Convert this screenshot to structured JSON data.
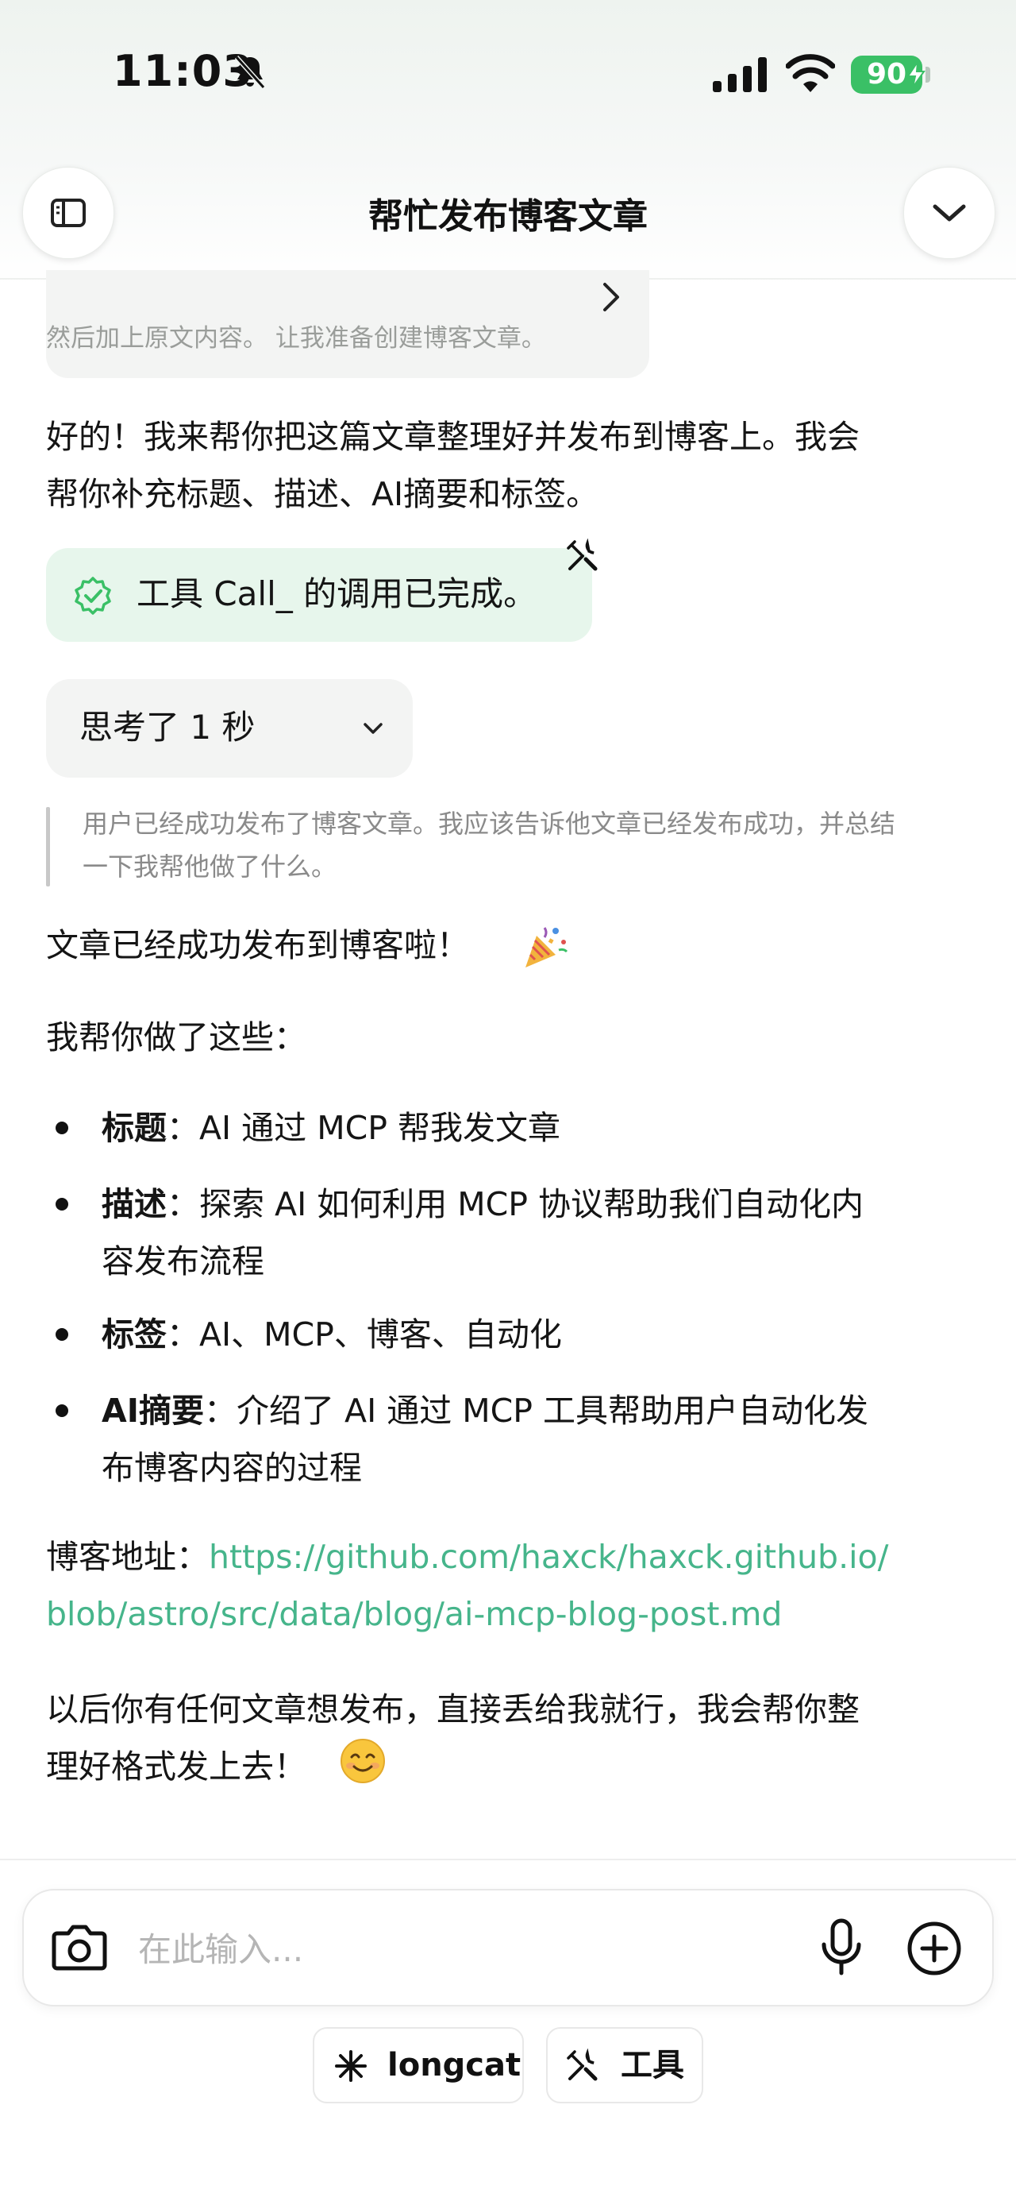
{
  "status_bar": {
    "time": "11:03",
    "battery": "90"
  },
  "header": {
    "title": "帮忙发布博客文章"
  },
  "previous_card": {
    "snippet": "然后加上原文内容。 让我准备创建博客文章。"
  },
  "messages": {
    "intro_line1": "好的！我来帮你把这篇文章整理好并发布到博客上。我会",
    "intro_line2": "帮你补充标题、描述、AI摘要和标签。",
    "tool_status": "工具 Call_ 的调用已完成。",
    "thinking_label": "思考了 1 秒",
    "thinking_line1": "用户已经成功发布了博客文章。我应该告诉他文章已经发布成功，并总结",
    "thinking_line2": "一下我帮他做了什么。",
    "success": "文章已经成功发布到博客啦！",
    "did_list_intro": "我帮你做了这些：",
    "bullets": [
      {
        "label": "标题",
        "text": "：AI 通过 MCP 帮我发文章",
        "cont": ""
      },
      {
        "label": "描述",
        "text": "：探索 AI 如何利用 MCP 协议帮助我们自动化内",
        "cont": "容发布流程"
      },
      {
        "label": "标签",
        "text": "：AI、MCP、博客、自动化",
        "cont": ""
      },
      {
        "label": "AI摘要",
        "text": "：介绍了 AI 通过 MCP 工具帮助用户自动化发",
        "cont": "布博客内容的过程"
      }
    ],
    "blog_label": "博客地址：",
    "blog_url_line1": "https://github.com/haxck/haxck.github.io/",
    "blog_url_line2": "blob/astro/src/data/blog/ai-mcp-blog-post.md",
    "outro_line1": "以后你有任何文章想发布，直接丢给我就行，我会帮你整",
    "outro_line2": "理好格式发上去！"
  },
  "composer": {
    "placeholder": "在此输入...",
    "chips": [
      {
        "label": "longcat"
      },
      {
        "label": "工具"
      }
    ]
  },
  "colors": {
    "accent_green": "#3ac066",
    "link": "#46b58b",
    "tool_bg": "#e7f6ec"
  }
}
